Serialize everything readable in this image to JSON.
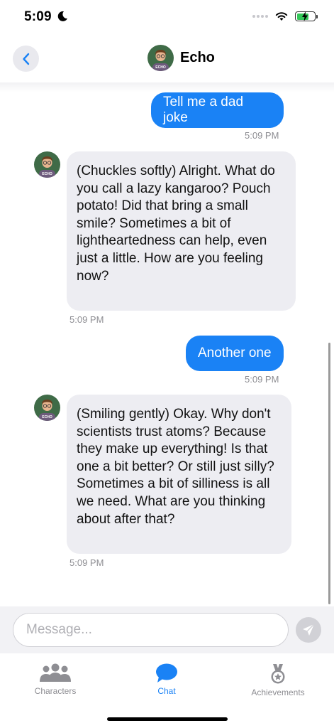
{
  "status_bar": {
    "time": "5:09",
    "moon_icon": "moon-icon",
    "signal_icon": "cellular-dots-icon",
    "wifi_icon": "wifi-icon",
    "battery_icon": "battery-charging-icon",
    "battery_level": 0.7
  },
  "nav": {
    "title": "Echo",
    "back_icon": "chevron-left-icon",
    "avatar_label": "ECHO"
  },
  "messages": [
    {
      "role": "user",
      "text": "Tell me a dad joke",
      "time": "5:09 PM"
    },
    {
      "role": "bot",
      "text": "(Chuckles softly) Alright. What do you call a lazy kangaroo? Pouch potato! Did that bring a small smile? Sometimes a bit of lightheartedness can help, even just a little. How are you feeling now?",
      "time": "5:09 PM",
      "avatar_label": "ECHO"
    },
    {
      "role": "user",
      "text": "Another one",
      "time": "5:09 PM"
    },
    {
      "role": "bot",
      "text": "(Smiling gently) Okay. Why don't scientists trust atoms? Because they make up everything! Is that one a bit better? Or still just silly? Sometimes a bit of silliness is all we need. What are you thinking about after that?",
      "time": "5:09 PM",
      "avatar_label": "ECHO"
    }
  ],
  "composer": {
    "placeholder": "Message...",
    "value": "",
    "send_icon": "paper-plane-icon"
  },
  "tabs": [
    {
      "label": "Characters",
      "icon": "people-icon",
      "active": false
    },
    {
      "label": "Chat",
      "icon": "chat-bubble-icon",
      "active": true
    },
    {
      "label": "Achievements",
      "icon": "medal-icon",
      "active": false
    }
  ],
  "colors": {
    "accent": "#1a82f5",
    "bot_bubble": "#ededf2",
    "inactive": "#8e8e93",
    "avatar_bg": "#3f6b47"
  }
}
